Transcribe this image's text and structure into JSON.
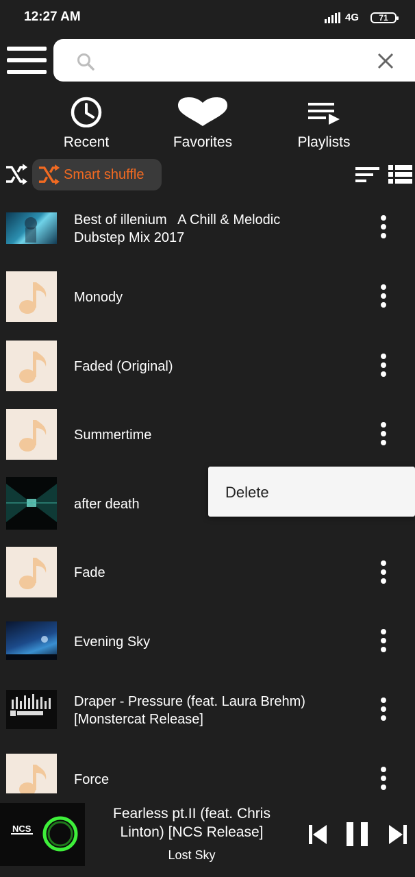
{
  "status_bar": {
    "time": "12:27 AM",
    "network": "4G",
    "battery": "71"
  },
  "search": {
    "placeholder": "",
    "value": ""
  },
  "nav": [
    {
      "label": "Recent",
      "icon": "clock-icon"
    },
    {
      "label": "Favorites",
      "icon": "heart-icon"
    },
    {
      "label": "Playlists",
      "icon": "playlist-icon"
    }
  ],
  "toolbar": {
    "smart_shuffle_label": "Smart shuffle",
    "accent": "#f26a21"
  },
  "tracks": [
    {
      "title": "Best of illenium   A Chill & Melodic\nDubstep Mix 2017",
      "thumb": "image"
    },
    {
      "title": "Monody",
      "thumb": "music-note"
    },
    {
      "title": "Faded (Original)",
      "thumb": "music-note"
    },
    {
      "title": "Summertime",
      "thumb": "music-note"
    },
    {
      "title": "after death",
      "thumb": "image"
    },
    {
      "title": "Fade",
      "thumb": "music-note"
    },
    {
      "title": "Evening Sky",
      "thumb": "image"
    },
    {
      "title": "Draper - Pressure (feat. Laura Brehm)\n[Monstercat Release]",
      "thumb": "image"
    },
    {
      "title": "Force",
      "thumb": "music-note"
    }
  ],
  "popup_menu": {
    "items": [
      "Delete"
    ]
  },
  "now_playing": {
    "title": "Fearless pt.II (feat. Chris Linton) [NCS Release]",
    "artist": "Lost Sky",
    "art_text": "NCS"
  },
  "colors": {
    "background": "#1f1f1f",
    "accent": "#f26a21",
    "note_thumb_bg": "#f3e8dd",
    "note_color": "#f2c89b"
  }
}
